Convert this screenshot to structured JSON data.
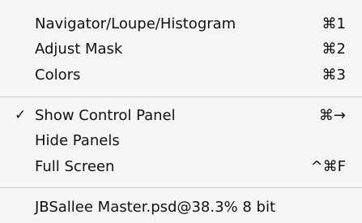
{
  "menu": {
    "items": [
      {
        "label": "Navigator/Loupe/Histogram",
        "shortcut": "⌘1",
        "checked": false
      },
      {
        "label": "Adjust Mask",
        "shortcut": "⌘2",
        "checked": false
      },
      {
        "label": "Colors",
        "shortcut": "⌘3",
        "checked": false
      },
      {
        "label": "Show Control Panel",
        "shortcut": "⌘→",
        "checked": true,
        "check_glyph": "✓"
      },
      {
        "label": "Hide Panels",
        "shortcut": "",
        "checked": false
      },
      {
        "label": "Full Screen",
        "shortcut": "^⌘F",
        "checked": false
      },
      {
        "label": "JBSallee Master.psd@38.3% 8 bit",
        "shortcut": "",
        "checked": false
      }
    ]
  }
}
